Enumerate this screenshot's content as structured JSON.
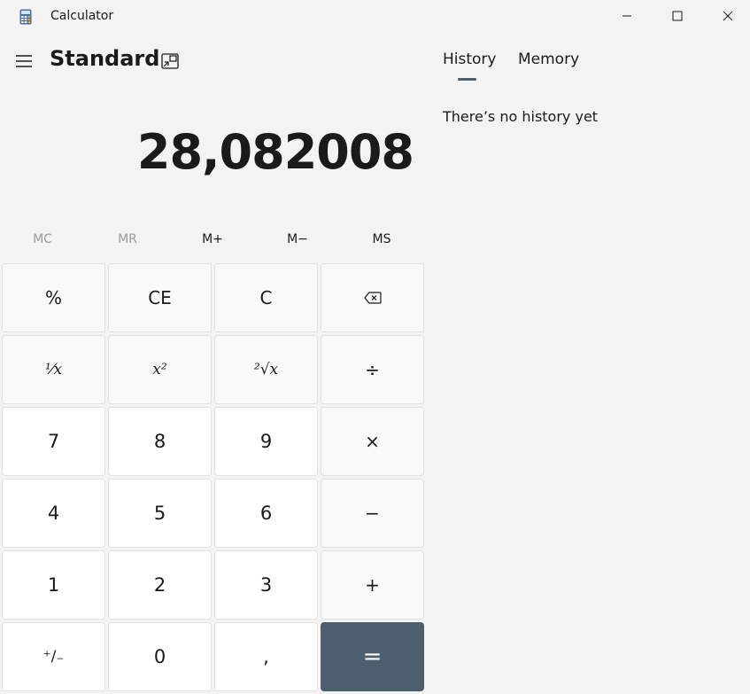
{
  "window": {
    "title": "Calculator",
    "icons": [
      "calculator-app-icon",
      "minimize-icon",
      "maximize-icon",
      "close-icon"
    ]
  },
  "header": {
    "mode": "Standard",
    "icons": [
      "hamburger-menu-icon",
      "keep-on-top-icon"
    ]
  },
  "display": {
    "value": "28,082008"
  },
  "memory": {
    "buttons": [
      {
        "label": "MC",
        "enabled": false
      },
      {
        "label": "MR",
        "enabled": false
      },
      {
        "label": "M+",
        "enabled": true
      },
      {
        "label": "M−",
        "enabled": true
      },
      {
        "label": "MS",
        "enabled": true
      }
    ]
  },
  "keys": {
    "percent": "%",
    "clear_entry": "CE",
    "clear": "C",
    "backspace_icon": "backspace-icon",
    "reciprocal": "¹⁄x",
    "square": "x²",
    "sqrt": "²√x",
    "divide": "÷",
    "seven": "7",
    "eight": "8",
    "nine": "9",
    "multiply": "×",
    "four": "4",
    "five": "5",
    "six": "6",
    "minus": "−",
    "one": "1",
    "two": "2",
    "three": "3",
    "plus": "+",
    "negate": "⁺/₋",
    "zero": "0",
    "decimal": ",",
    "equals": "="
  },
  "panel": {
    "tabs": [
      "History",
      "Memory"
    ],
    "active_tab": "History",
    "empty_message": "There’s no history yet"
  },
  "colors": {
    "background": "#f3f3f3",
    "accent": "#4b5f6d",
    "number_key": "#ffffff",
    "operator_key": "#f9f9f9"
  }
}
